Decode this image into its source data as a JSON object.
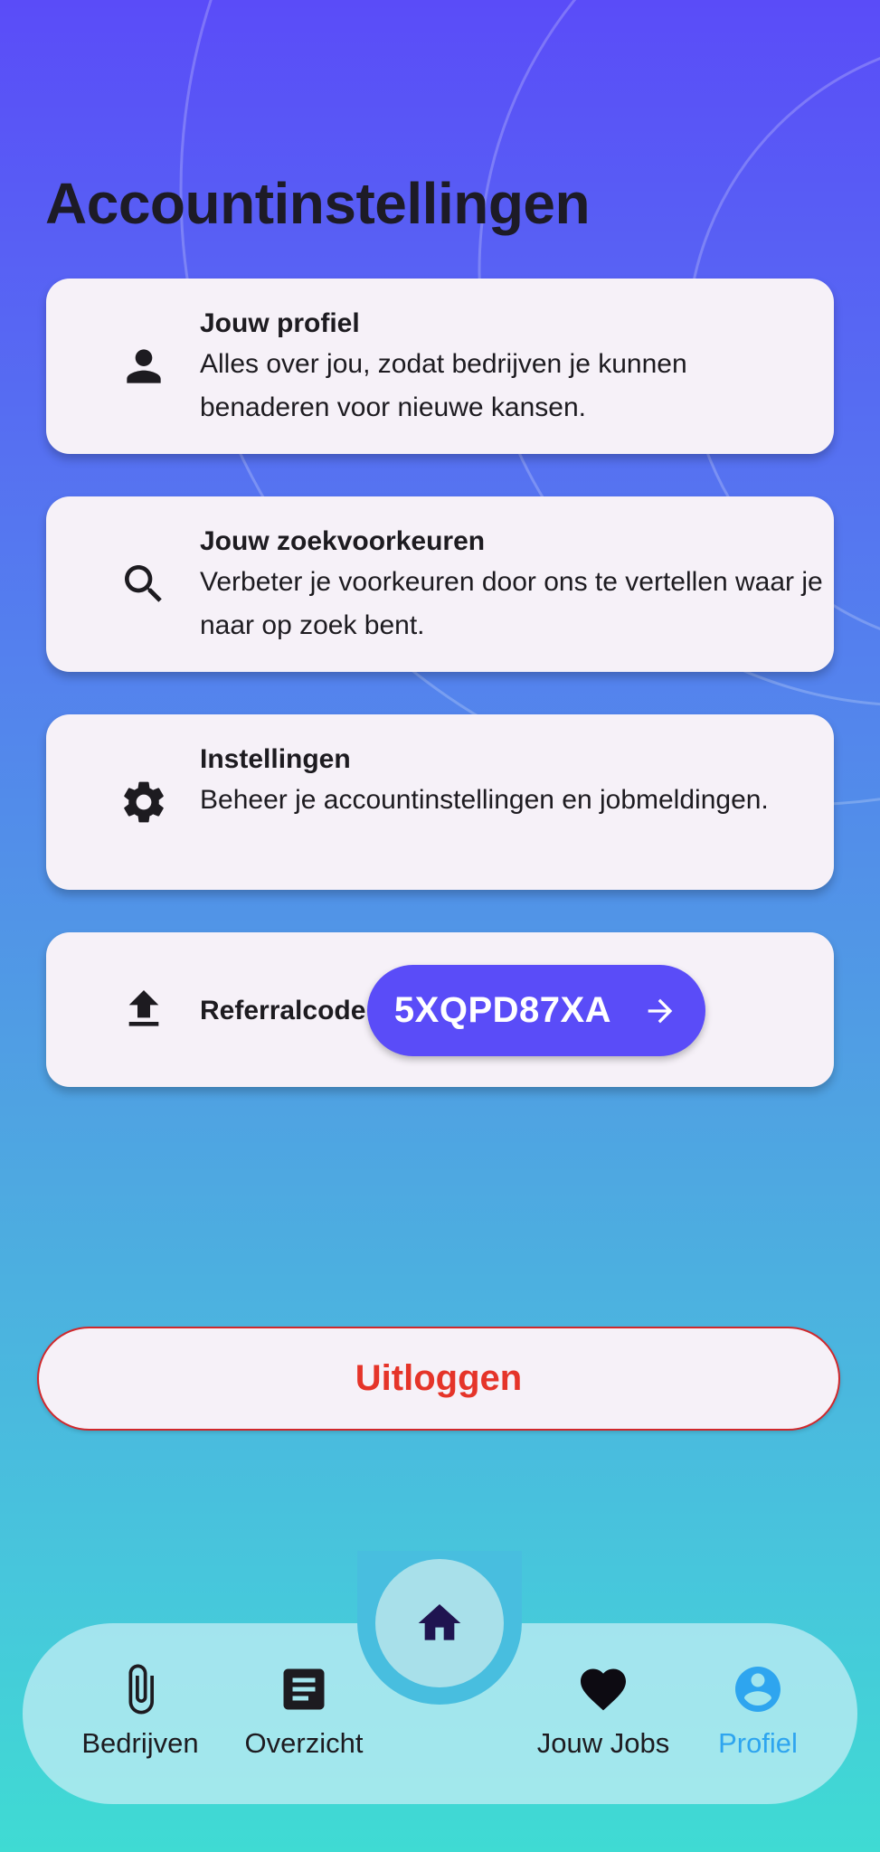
{
  "page": {
    "title": "Accountinstellingen"
  },
  "cards": [
    {
      "icon": "person-icon",
      "title": "Jouw profiel",
      "description": "Alles over jou, zodat bedrijven je kunnen benaderen voor nieuwe kansen."
    },
    {
      "icon": "search-icon",
      "title": "Jouw zoekvoorkeuren",
      "description": "Verbeter je voorkeuren door ons te vertellen waar je naar op zoek bent."
    },
    {
      "icon": "gear-icon",
      "title": "Instellingen",
      "description": "Beheer je accountinstellingen en jobmeldingen."
    }
  ],
  "referral": {
    "icon": "upload-icon",
    "label": "Referralcode:",
    "code": "5XQPD87XA"
  },
  "logout": {
    "label": "Uitloggen"
  },
  "nav": {
    "home_icon": "home-icon",
    "items": [
      {
        "label": "Bedrijven",
        "icon": "paperclip-icon",
        "active": false
      },
      {
        "label": "Overzicht",
        "icon": "article-icon",
        "active": false
      },
      {
        "label": "Jouw Jobs",
        "icon": "heart-icon",
        "active": false
      },
      {
        "label": "Profiel",
        "icon": "account-circle-icon",
        "active": true
      }
    ]
  },
  "colors": {
    "accent": "#5a4cf8",
    "danger": "#e53429",
    "active_nav": "#2ea5ef",
    "card_bg": "#f6f1f8"
  }
}
